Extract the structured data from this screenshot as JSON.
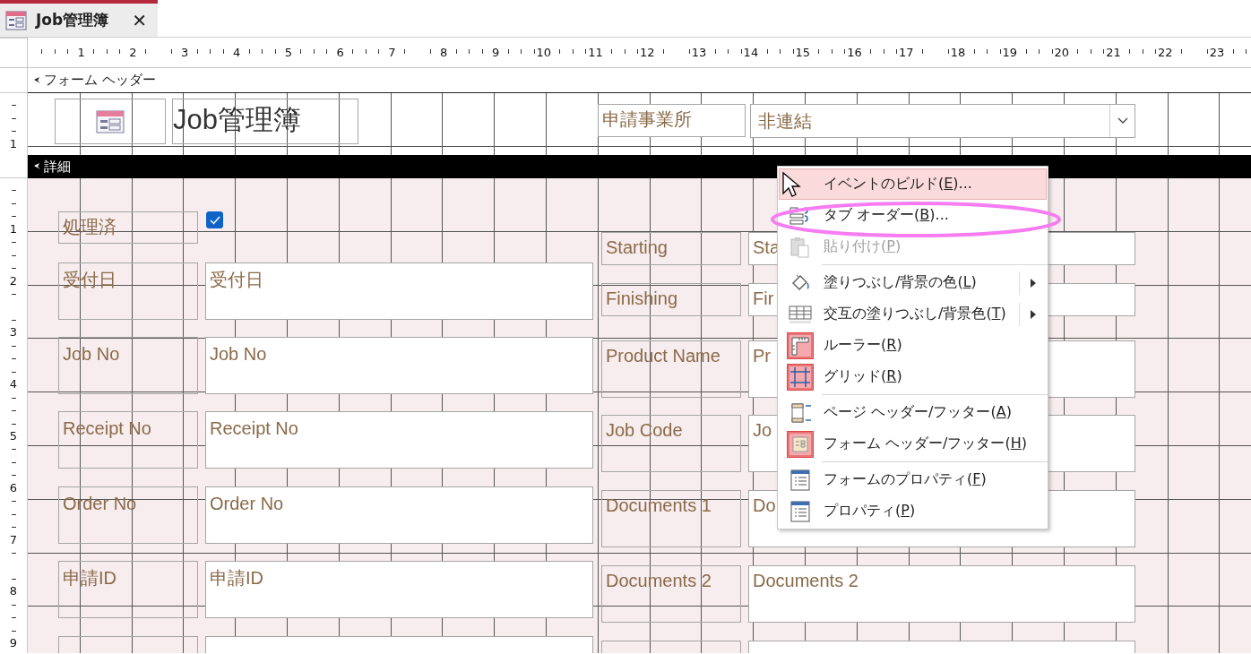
{
  "tab": {
    "title": "Job管理簿",
    "close": "✕"
  },
  "ruler": {
    "marks": [
      "1",
      "2",
      "3",
      "4",
      "5",
      "6",
      "7",
      "8",
      "9",
      "10",
      "11",
      "12",
      "13",
      "14",
      "15",
      "16",
      "17",
      "18",
      "19",
      "20",
      "21",
      "22",
      "23"
    ]
  },
  "vertical_ruler": {
    "header_marks": [
      "1"
    ],
    "detail_marks": [
      "1",
      "2",
      "3",
      "4",
      "5",
      "6",
      "7",
      "8",
      "9"
    ]
  },
  "form_header": {
    "section_label": "フォーム ヘッダー",
    "title": "Job管理簿",
    "office_label": "申請事業所",
    "office_value": "非連結"
  },
  "detail": {
    "section_label": "詳細",
    "checkbox": {
      "label": "処理済",
      "checked": true
    },
    "left_fields": [
      {
        "label": "受付日",
        "value": "受付日"
      },
      {
        "label": "Job No",
        "value": "Job No"
      },
      {
        "label": "Receipt No",
        "value": "Receipt No"
      },
      {
        "label": "Order No",
        "value": "Order No"
      },
      {
        "label": "申請ID",
        "value": "申請ID"
      }
    ],
    "right_fields": [
      {
        "label": "Starting",
        "value": "Sta"
      },
      {
        "label": "Finishing",
        "value": "Fir"
      },
      {
        "label": "Product Name",
        "value": "Pr"
      },
      {
        "label": "Job Code",
        "value": "Jo"
      },
      {
        "label": "Documents 1",
        "value": "Do"
      },
      {
        "label": "Documents 2",
        "value": "Documents 2"
      }
    ]
  },
  "context_menu": {
    "groups": [
      [
        {
          "text": "イベントのビルド(",
          "key": "E",
          "rest": ")...",
          "selected": true,
          "disabled": false,
          "submenu": false,
          "on": false
        },
        {
          "text": "タブ オーダー(",
          "key": "B",
          "rest": ")...",
          "selected": false,
          "disabled": false,
          "submenu": false,
          "on": false
        },
        {
          "text": "貼り付け(",
          "key": "P",
          "rest": ")",
          "selected": false,
          "disabled": true,
          "submenu": false,
          "on": false
        }
      ],
      [
        {
          "text": "塗りつぶし/背景の色(",
          "key": "L",
          "rest": ")",
          "selected": false,
          "disabled": false,
          "submenu": true,
          "on": false
        },
        {
          "text": "交互の塗りつぶし/背景色(",
          "key": "T",
          "rest": ")",
          "selected": false,
          "disabled": false,
          "submenu": true,
          "on": false
        },
        {
          "text": "ルーラー(",
          "key": "R",
          "rest": ")",
          "selected": false,
          "disabled": false,
          "submenu": false,
          "on": true
        },
        {
          "text": "グリッド(",
          "key": "R",
          "rest": ")",
          "selected": false,
          "disabled": false,
          "submenu": false,
          "on": true
        }
      ],
      [
        {
          "text": "ページ ヘッダー/フッター(",
          "key": "A",
          "rest": ")",
          "selected": false,
          "disabled": false,
          "submenu": false,
          "on": false
        },
        {
          "text": "フォーム ヘッダー/フッター(",
          "key": "H",
          "rest": ")",
          "selected": false,
          "disabled": false,
          "submenu": false,
          "on": true
        }
      ],
      [
        {
          "text": "フォームのプロパティ(",
          "key": "F",
          "rest": ")",
          "selected": false,
          "disabled": false,
          "submenu": false,
          "on": false
        },
        {
          "text": "プロパティ(",
          "key": "P",
          "rest": ")",
          "selected": false,
          "disabled": false,
          "submenu": false,
          "on": false
        }
      ]
    ]
  }
}
